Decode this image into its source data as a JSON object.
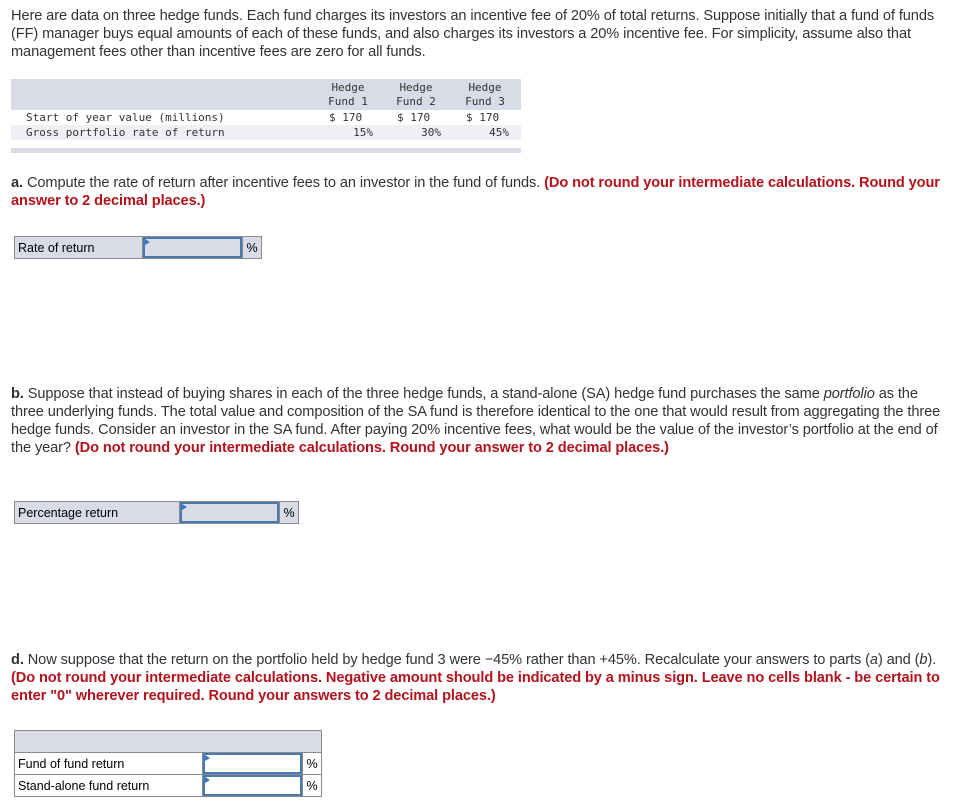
{
  "intro": "Here are data on three hedge funds. Each fund charges its investors an incentive fee of 20% of total returns. Suppose initially that a fund of funds (FF) manager buys equal amounts of each of these funds, and also charges its investors a 20% incentive fee. For simplicity, assume also that management fees other than incentive fees are zero for all funds.",
  "data_table": {
    "columns": [
      {
        "line1": "Hedge",
        "line2": "Fund 1"
      },
      {
        "line1": "Hedge",
        "line2": "Fund 2"
      },
      {
        "line1": "Hedge",
        "line2": "Fund 3"
      }
    ],
    "rows": [
      {
        "label": "Start of year value (millions)",
        "values": [
          "$ 170",
          "$ 170",
          "$ 170"
        ]
      },
      {
        "label": "Gross portfolio rate of return",
        "values": [
          "15%",
          "30%",
          "45%"
        ]
      }
    ]
  },
  "part_a": {
    "letter": "a.",
    "text": " Compute the rate of return after incentive fees to an investor in the fund of funds. ",
    "instruction": "(Do not round your intermediate calculations. Round your answer to 2 decimal places.)",
    "row_label": "Rate of return",
    "input_value": "",
    "unit": "%"
  },
  "part_b": {
    "letter": "b.",
    "text1": " Suppose that instead of buying shares in each of the three hedge funds, a stand-alone (SA) hedge fund purchases the same ",
    "italic": "portfolio",
    "text2": " as the three underlying funds. The total value and composition of the SA fund is therefore identical to the one that would result from aggregating the three hedge funds. Consider an investor in the SA fund. After paying 20% incentive fees, what would be the value of the investor’s portfolio at the end of the year? ",
    "instruction": "(Do not round your intermediate calculations. Round your answer to 2 decimal places.)",
    "row_label": "Percentage return",
    "input_value": "",
    "unit": "%"
  },
  "part_d": {
    "letter": "d.",
    "text1": " Now suppose that the return on the portfolio held by hedge fund 3 were −45% rather than +45%. Recalculate your answers to parts (",
    "ref_a": "a",
    "text_mid": ") and (",
    "ref_b": "b",
    "text2": "). ",
    "instruction": "(Do not round your intermediate calculations. Negative amount should be indicated by a minus sign. Leave no cells blank - be certain to enter \"0\" wherever required. Round your answers to 2 decimal places.)",
    "rows": [
      {
        "label": "Fund of fund return",
        "input_value": "",
        "unit": "%"
      },
      {
        "label": "Stand-alone fund return",
        "input_value": "",
        "unit": "%"
      }
    ]
  },
  "colors": {
    "instruction_red": "#b4131d",
    "table_header_bg": "#d9dce6",
    "input_border": "#4a78b0"
  }
}
